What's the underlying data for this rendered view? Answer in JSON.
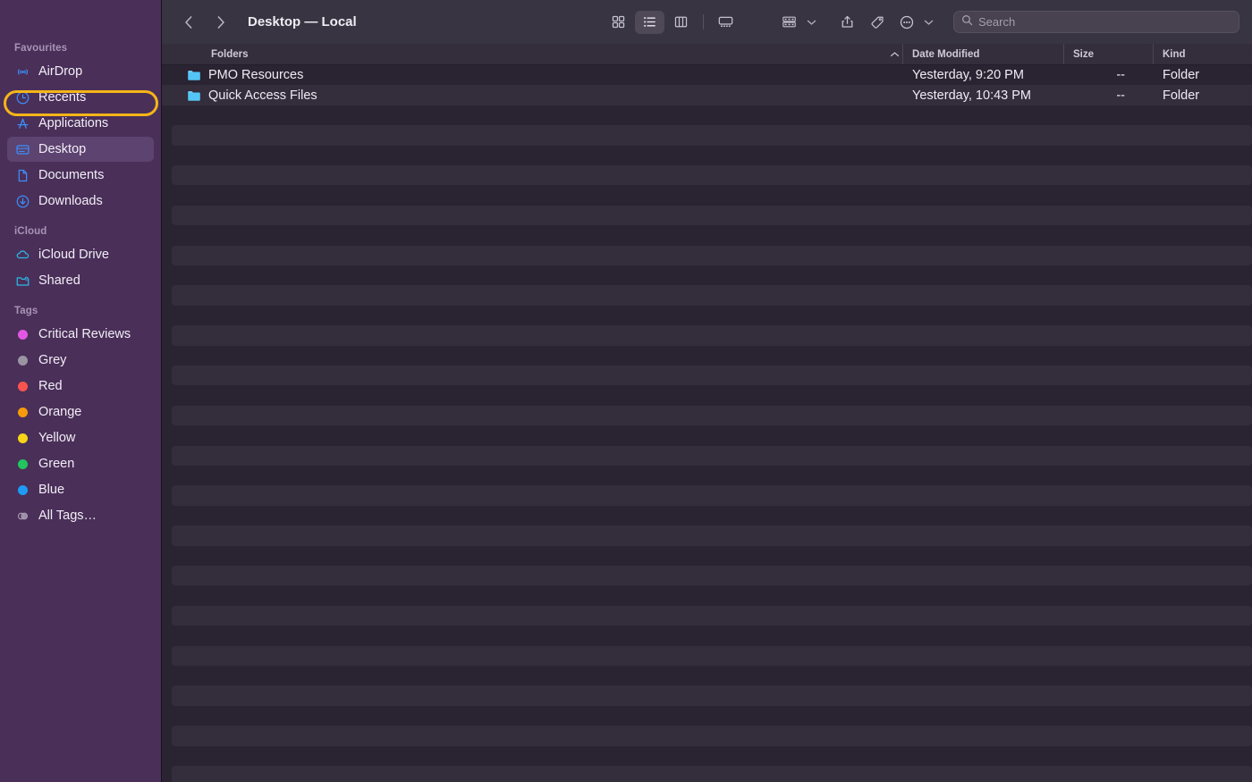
{
  "window": {
    "title": "Desktop — Local"
  },
  "toolbar": {
    "back_icon": "chevron-left-icon",
    "forward_icon": "chevron-right-icon",
    "view_icon_grid": "grid-view-icon",
    "view_icon_list": "list-view-icon",
    "view_icon_columns": "column-view-icon",
    "view_icon_gallery": "gallery-view-icon",
    "active_view": "list",
    "group_icon": "group-by-icon",
    "share_icon": "share-icon",
    "tag_icon": "tag-icon",
    "more_icon": "more-actions-icon",
    "search": {
      "icon": "search-icon",
      "placeholder": "Search",
      "value": ""
    }
  },
  "sidebar": {
    "sections": [
      {
        "title": "Favourites",
        "items": [
          {
            "label": "AirDrop",
            "icon": "airdrop-icon",
            "selected": false
          },
          {
            "label": "Recents",
            "icon": "clock-icon",
            "selected": false,
            "annotated": true
          },
          {
            "label": "Applications",
            "icon": "applications-icon",
            "selected": false
          },
          {
            "label": "Desktop",
            "icon": "desktop-icon",
            "selected": true
          },
          {
            "label": "Documents",
            "icon": "document-icon",
            "selected": false
          },
          {
            "label": "Downloads",
            "icon": "downloads-icon",
            "selected": false
          }
        ]
      },
      {
        "title": "iCloud",
        "items": [
          {
            "label": "iCloud Drive",
            "icon": "cloud-icon",
            "selected": false
          },
          {
            "label": "Shared",
            "icon": "shared-folder-icon",
            "selected": false
          }
        ]
      },
      {
        "title": "Tags",
        "items": [
          {
            "label": "Critical Reviews",
            "icon": "tag-dot-icon",
            "color": "#e койд",
            "selected": false
          },
          {
            "label": "Grey",
            "icon": "tag-dot-icon",
            "color": "#9a94a3",
            "selected": false
          },
          {
            "label": "Red",
            "icon": "tag-dot-icon",
            "color": "#f8544f",
            "selected": false
          },
          {
            "label": "Orange",
            "icon": "tag-dot-icon",
            "color": "#f59b0b",
            "selected": false
          },
          {
            "label": "Yellow",
            "icon": "tag-dot-icon",
            "color": "#f7d417",
            "selected": false
          },
          {
            "label": "Green",
            "icon": "tag-dot-icon",
            "color": "#22c councils",
            "selected": false
          },
          {
            "label": "Blue",
            "icon": "tag-dot-icon",
            "color": "#1e9bf5",
            "selected": false
          },
          {
            "label": "All Tags…",
            "icon": "all-tags-icon",
            "selected": false
          }
        ]
      }
    ]
  },
  "file_list": {
    "columns": [
      {
        "key": "name",
        "label": "Folders"
      },
      {
        "key": "sort",
        "label": ""
      },
      {
        "key": "date",
        "label": "Date Modified"
      },
      {
        "key": "size",
        "label": "Size"
      },
      {
        "key": "kind",
        "label": "Kind"
      }
    ],
    "sort_indicator": "chevron-up-icon",
    "rows": [
      {
        "name": "PMO Resources",
        "icon": "folder-icon",
        "date": "Yesterday, 9:20 PM",
        "size": "--",
        "kind": "Folder"
      },
      {
        "name": "Quick Access Files",
        "icon": "folder-icon",
        "date": "Yesterday, 10:43 PM",
        "size": "--",
        "kind": "Folder"
      }
    ]
  },
  "annotation": {
    "target": "Recents",
    "color": "#f5b518"
  }
}
